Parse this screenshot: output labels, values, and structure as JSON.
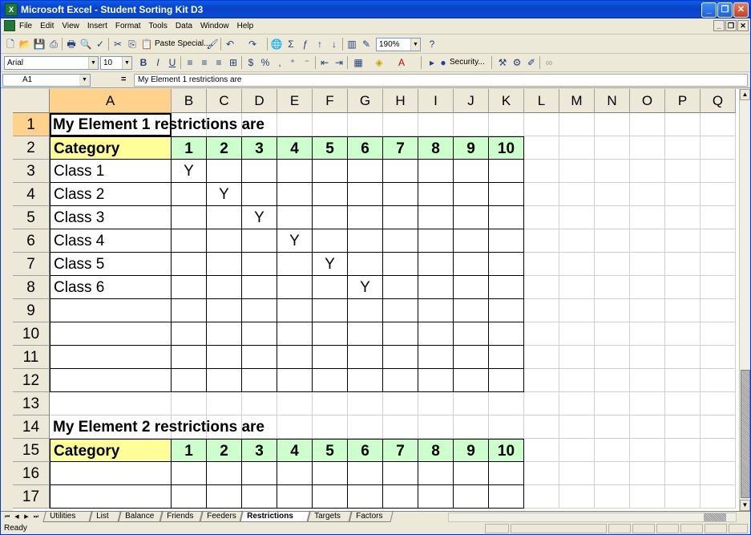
{
  "window": {
    "title": "Microsoft Excel - Student Sorting Kit D3",
    "app_icon": "excel-icon"
  },
  "menu": {
    "items": [
      "File",
      "Edit",
      "View",
      "Insert",
      "Format",
      "Tools",
      "Data",
      "Window",
      "Help"
    ]
  },
  "toolbar": {
    "paste_special": "Paste Special...",
    "zoom": "190%",
    "font": "Arial",
    "font_size": "10",
    "security": "Security..."
  },
  "formula_bar": {
    "name_box": "A1",
    "equals": "=",
    "content": "My Element 1 restrictions are"
  },
  "columns": [
    "A",
    "B",
    "C",
    "D",
    "E",
    "F",
    "G",
    "H",
    "I",
    "J",
    "K",
    "L",
    "M",
    "N",
    "O",
    "P",
    "Q"
  ],
  "rows": [
    "1",
    "2",
    "3",
    "4",
    "5",
    "6",
    "7",
    "8",
    "9",
    "10",
    "11",
    "12",
    "13",
    "14",
    "15",
    "16",
    "17"
  ],
  "sheet": {
    "block1_title": "My Element 1 restrictions are",
    "block2_title": "My Element 2 restrictions are",
    "category_label": "Category",
    "category_numbers": [
      "1",
      "2",
      "3",
      "4",
      "5",
      "6",
      "7",
      "8",
      "9",
      "10"
    ],
    "classes": [
      "Class 1",
      "Class 2",
      "Class 3",
      "Class 4",
      "Class 5",
      "Class 6"
    ],
    "marker": "Y"
  },
  "tabs": [
    "Utilities",
    "List",
    "Balance",
    "Friends",
    "Feeders",
    "Restrictions",
    "Targets",
    "Factors"
  ],
  "active_tab": "Restrictions",
  "status": {
    "text": "Ready"
  },
  "colors": {
    "category_fill": "#ffff99",
    "number_fill": "#ccffcc",
    "selected_header": "#ffd28b"
  }
}
